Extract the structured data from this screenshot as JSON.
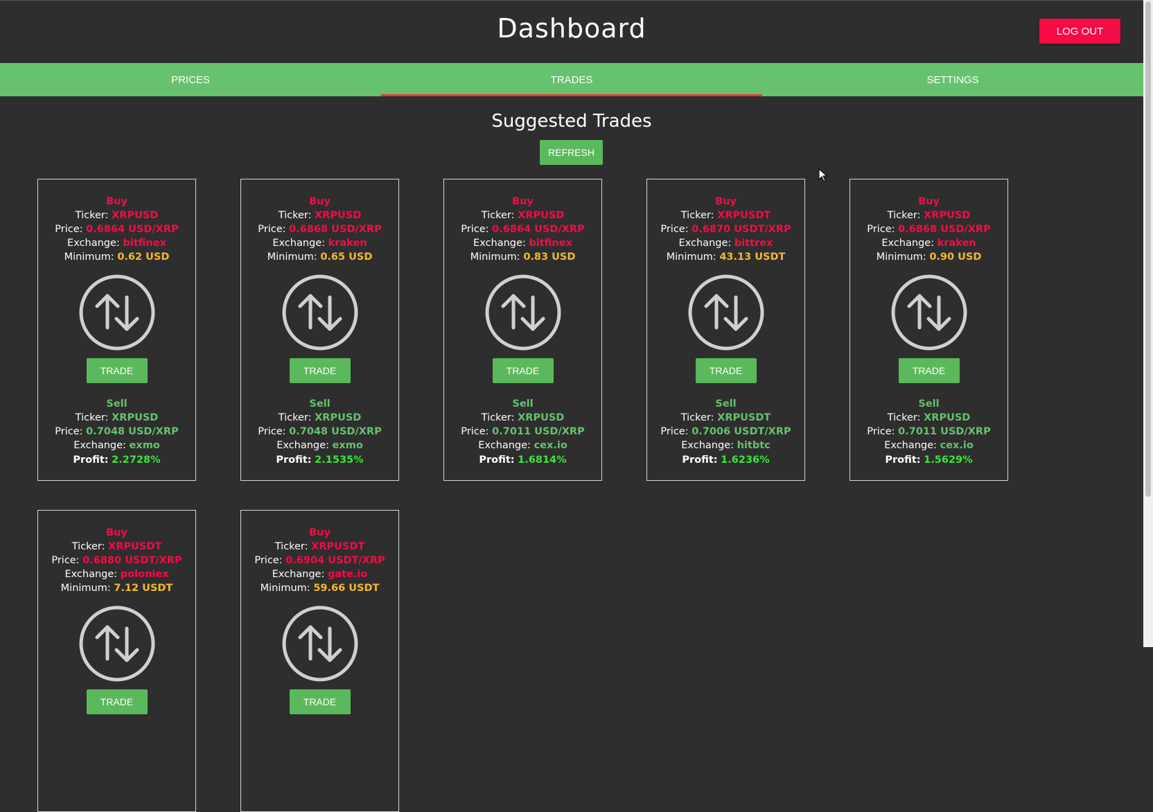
{
  "header": {
    "title": "Dashboard",
    "logout_label": "LOG OUT"
  },
  "tabs": [
    {
      "label": "PRICES",
      "active": false
    },
    {
      "label": "TRADES",
      "active": true
    },
    {
      "label": "SETTINGS",
      "active": false
    }
  ],
  "main": {
    "heading": "Suggested Trades",
    "refresh_label": "REFRESH"
  },
  "labels": {
    "buy": "Buy",
    "sell": "Sell",
    "ticker": "Ticker:",
    "price": "Price:",
    "exchange": "Exchange:",
    "minimum": "Minimum:",
    "profit": "Profit:",
    "trade_button": "TRADE"
  },
  "colors": {
    "accent_red": "#f50c45",
    "accent_green": "#66c26e",
    "profit_green": "#39e639",
    "minimum_yellow": "#f7b831",
    "background": "#2e2e2e"
  },
  "icons": {
    "trade": "swap-vertical-icon",
    "cursor": "mouse-pointer-icon"
  },
  "cards": [
    {
      "buy": {
        "ticker": "XRPUSD",
        "price": "0.6864 USD/XRP",
        "exchange": "bitfinex",
        "minimum": "0.62 USD"
      },
      "sell": {
        "ticker": "XRPUSD",
        "price": "0.7048 USD/XRP",
        "exchange": "exmo"
      },
      "profit": "2.2728%"
    },
    {
      "buy": {
        "ticker": "XRPUSD",
        "price": "0.6868 USD/XRP",
        "exchange": "kraken",
        "minimum": "0.65 USD"
      },
      "sell": {
        "ticker": "XRPUSD",
        "price": "0.7048 USD/XRP",
        "exchange": "exmo"
      },
      "profit": "2.1535%"
    },
    {
      "buy": {
        "ticker": "XRPUSD",
        "price": "0.6864 USD/XRP",
        "exchange": "bitfinex",
        "minimum": "0.83 USD"
      },
      "sell": {
        "ticker": "XRPUSD",
        "price": "0.7011 USD/XRP",
        "exchange": "cex.io"
      },
      "profit": "1.6814%"
    },
    {
      "buy": {
        "ticker": "XRPUSDT",
        "price": "0.6870 USDT/XRP",
        "exchange": "bittrex",
        "minimum": "43.13 USDT"
      },
      "sell": {
        "ticker": "XRPUSDT",
        "price": "0.7006 USDT/XRP",
        "exchange": "hitbtc"
      },
      "profit": "1.6236%"
    },
    {
      "buy": {
        "ticker": "XRPUSD",
        "price": "0.6868 USD/XRP",
        "exchange": "kraken",
        "minimum": "0.90 USD"
      },
      "sell": {
        "ticker": "XRPUSD",
        "price": "0.7011 USD/XRP",
        "exchange": "cex.io"
      },
      "profit": "1.5629%"
    },
    {
      "buy": {
        "ticker": "XRPUSDT",
        "price": "0.6880 USDT/XRP",
        "exchange": "poloniex",
        "minimum": "7.12 USDT"
      }
    },
    {
      "buy": {
        "ticker": "XRPUSDT",
        "price": "0.6904 USDT/XRP",
        "exchange": "gate.io",
        "minimum": "59.66 USDT"
      }
    }
  ]
}
